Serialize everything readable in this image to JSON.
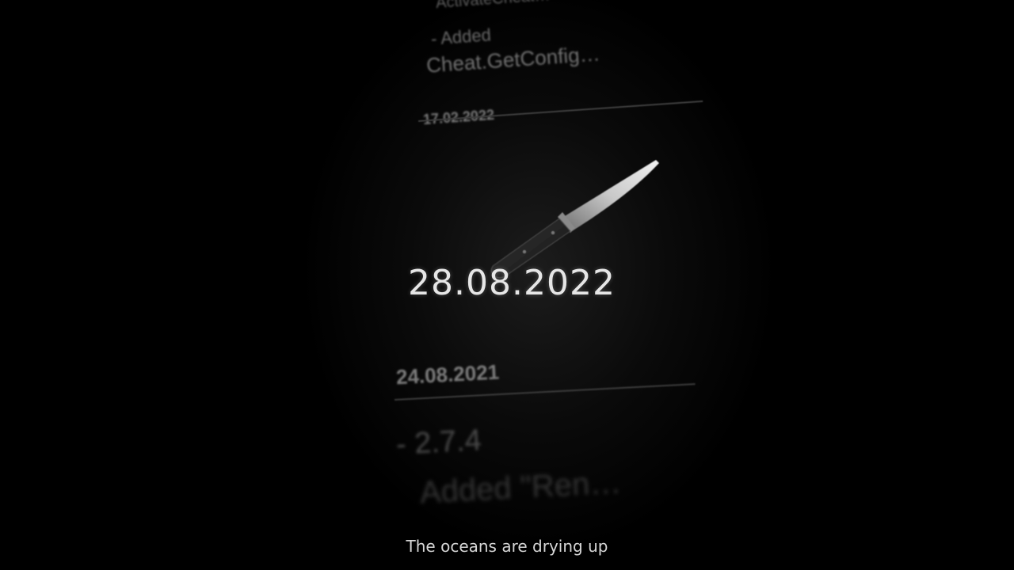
{
  "background_text": {
    "line1": "ActivateCheat…",
    "line2": "- Added",
    "line3": "Cheat.GetConfig…",
    "date1": "17.02.2022",
    "date2": "24.08.2021",
    "version": "- 2.7.4",
    "added2": "Added \"Ren…"
  },
  "overlay": {
    "main_date": "28.08.2022",
    "caption": "The oceans are drying up"
  },
  "icons": {
    "knife": "knife-icon"
  },
  "colors": {
    "background": "#000000",
    "overlay_text": "#e6e6e6",
    "caption_text": "#d6d6d6"
  }
}
